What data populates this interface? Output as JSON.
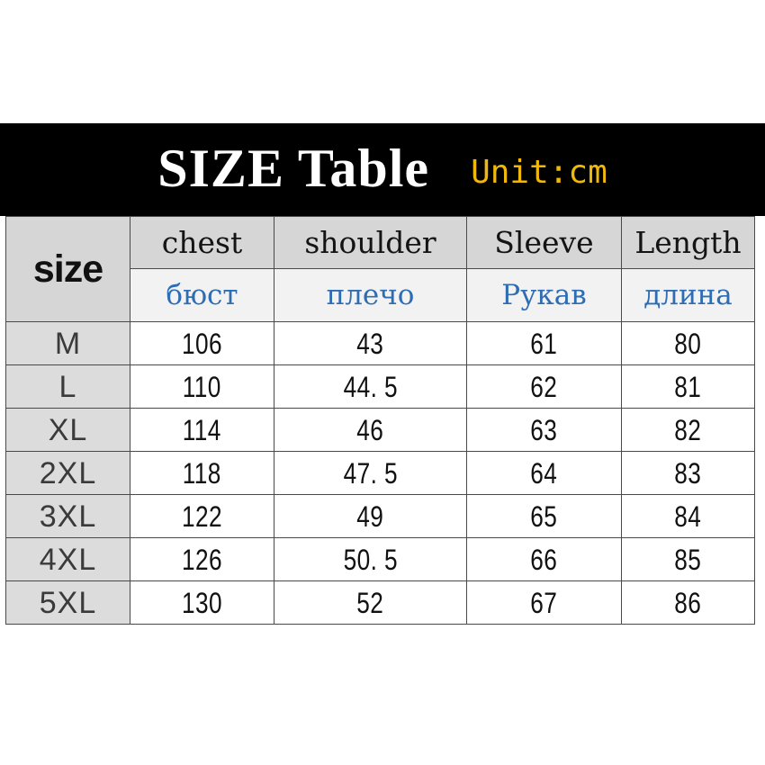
{
  "banner": {
    "title": "SIZE Table",
    "unit": "Unit:cm",
    "background_color": "#000000",
    "title_color": "#ffffff",
    "unit_color": "#f0b80a"
  },
  "table": {
    "size_header": "size",
    "headers_en": [
      "chest",
      "shoulder",
      "Sleeve",
      "Length"
    ],
    "headers_ru": [
      "бюст",
      "плечо",
      "Рукав",
      "длина"
    ],
    "header_en_color": "#141414",
    "header_ru_color": "#2e6db4",
    "rows": [
      {
        "size": "M",
        "chest": "106",
        "shoulder": "43",
        "sleeve": "61",
        "length": "80"
      },
      {
        "size": "L",
        "chest": "110",
        "shoulder": "44. 5",
        "sleeve": "62",
        "length": "81"
      },
      {
        "size": "XL",
        "chest": "114",
        "shoulder": "46",
        "sleeve": "63",
        "length": "82"
      },
      {
        "size": "2XL",
        "chest": "118",
        "shoulder": "47. 5",
        "sleeve": "64",
        "length": "83"
      },
      {
        "size": "3XL",
        "chest": "122",
        "shoulder": "49",
        "sleeve": "65",
        "length": "84"
      },
      {
        "size": "4XL",
        "chest": "126",
        "shoulder": "50. 5",
        "sleeve": "66",
        "length": "85"
      },
      {
        "size": "5XL",
        "chest": "130",
        "shoulder": "52",
        "sleeve": "67",
        "length": "86"
      }
    ]
  },
  "chart_data": {
    "type": "table",
    "title": "SIZE Table",
    "subtitle": "Unit:cm",
    "columns": [
      "size",
      "chest",
      "shoulder",
      "Sleeve",
      "Length"
    ],
    "columns_ru": [
      "",
      "бюст",
      "плечо",
      "Рукав",
      "длина"
    ],
    "units": "cm",
    "categories": [
      "M",
      "L",
      "XL",
      "2XL",
      "3XL",
      "4XL",
      "5XL"
    ],
    "series": [
      {
        "name": "chest",
        "values": [
          106,
          110,
          114,
          118,
          122,
          126,
          130
        ]
      },
      {
        "name": "shoulder",
        "values": [
          43,
          44.5,
          46,
          47.5,
          49,
          50.5,
          52
        ]
      },
      {
        "name": "Sleeve",
        "values": [
          61,
          62,
          63,
          64,
          65,
          66,
          67
        ]
      },
      {
        "name": "Length",
        "values": [
          80,
          81,
          82,
          83,
          84,
          85,
          86
        ]
      }
    ]
  }
}
